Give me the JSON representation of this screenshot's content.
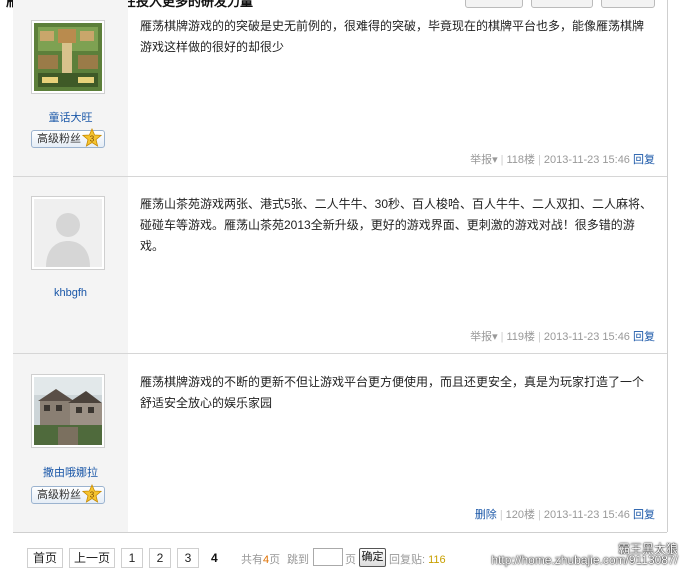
{
  "thread_title": "雁荡山棋牌游戏平台在投入更多的研发力量",
  "posts": [
    {
      "author": "童话大旺",
      "badge": "高级粉丝",
      "level": "3",
      "text": "雁荡棋牌游戏的的突破是史无前例的，很难得的突破，毕竟现在的棋牌平台也多，能像雁荡棋牌游戏这样做的很好的却很少",
      "report": "举报",
      "floor": "118楼",
      "time": "2013-11-23 15:46",
      "reply": "回复"
    },
    {
      "author": "khbgfh",
      "text": "雁荡山茶苑游戏两张、港式5张、二人牛牛、30秒、百人梭哈、百人牛牛、二人双扣、二人麻将、碰碰车等游戏。雁荡山茶苑2013全新升级，更好的游戏界面、更刺激的游戏对战！很多错的游戏。",
      "report": "举报",
      "floor": "119楼",
      "time": "2013-11-23 15:46",
      "reply": "回复"
    },
    {
      "author": "撒由哦娜拉",
      "badge": "高级粉丝",
      "level": "3",
      "text": "雁荡棋牌游戏的不断的更新不但让游戏平台更方便使用，而且还更安全，真是为玩家打造了一个舒适安全放心的娱乐家园",
      "report": "删除",
      "floor": "120楼",
      "time": "2013-11-23 15:46",
      "reply": "回复"
    }
  ],
  "pager": {
    "first": "首页",
    "prev": "上一页",
    "pages": [
      "1",
      "2",
      "3"
    ],
    "current": "4",
    "total_prefix": "共有",
    "total_pages": "4",
    "total_suffix": "页",
    "jump": "跳到",
    "page_unit": "页",
    "confirm": "确定",
    "reply_label": "回复贴:",
    "reply_count": "116"
  },
  "watermark": {
    "line1": "霸王黑太狼",
    "line2": "http://home.zhubajie.com/9113087/"
  }
}
